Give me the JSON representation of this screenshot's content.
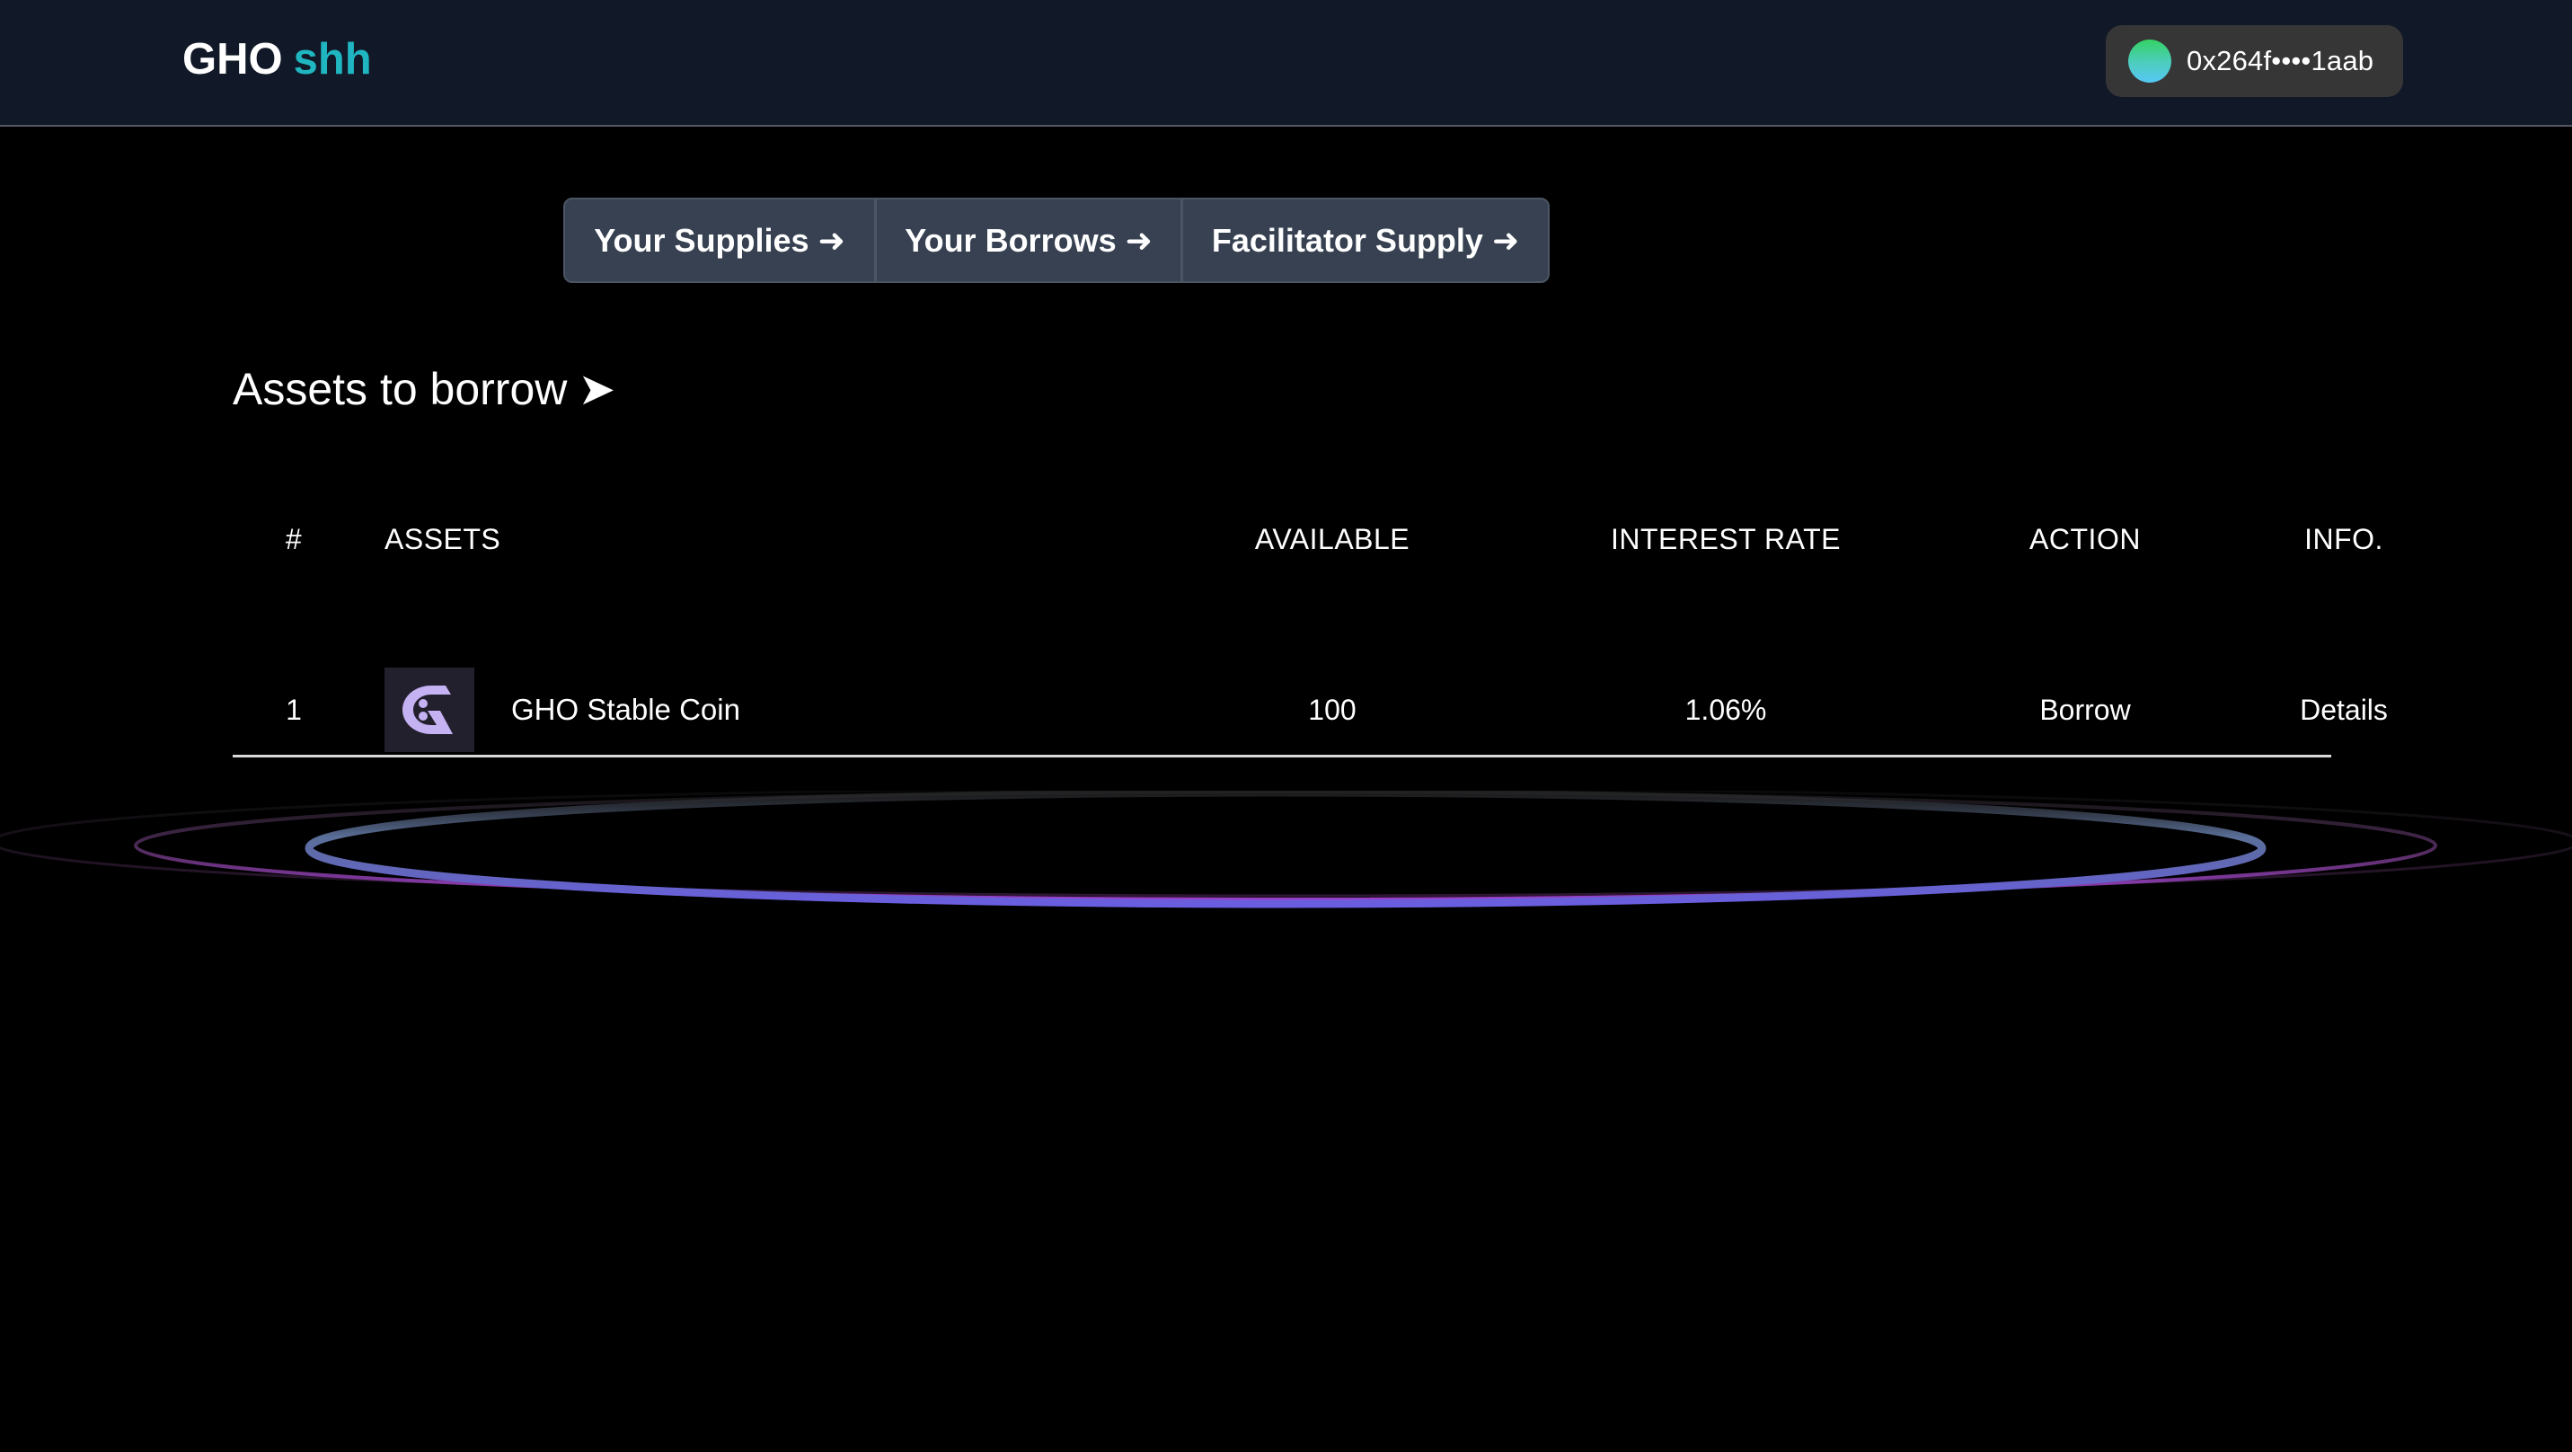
{
  "header": {
    "logo_primary": "GHO",
    "logo_accent": "shh",
    "wallet": {
      "address": "0x264f••••1aab",
      "avatar_icon": "wallet-avatar-gradient-dot"
    }
  },
  "nav": {
    "buttons": [
      {
        "label": "Your Supplies",
        "arrow": "➜"
      },
      {
        "label": "Your Borrows",
        "arrow": "➜"
      },
      {
        "label": "Facilitator Supply",
        "arrow": "➜"
      }
    ]
  },
  "section": {
    "title": "Assets to borrow",
    "pointer": "➤"
  },
  "table": {
    "columns": [
      "#",
      "ASSETS",
      "AVAILABLE",
      "INTEREST RATE",
      "ACTION",
      "INFO."
    ],
    "rows": [
      {
        "index": "1",
        "asset_icon": "gho-token-icon",
        "asset_name": "GHO Stable Coin",
        "available": "100",
        "interest_rate": "1.06%",
        "action": "Borrow",
        "info": "Details"
      }
    ]
  },
  "theme": {
    "header_bg": "#111827",
    "accent": "#20b6c1",
    "button_bg": "#374151",
    "wallet_bg": "#363636",
    "gho_purple": "#c9b3f5",
    "ring_blue": "#5b7fd8",
    "ring_purple": "#a04fd6"
  }
}
